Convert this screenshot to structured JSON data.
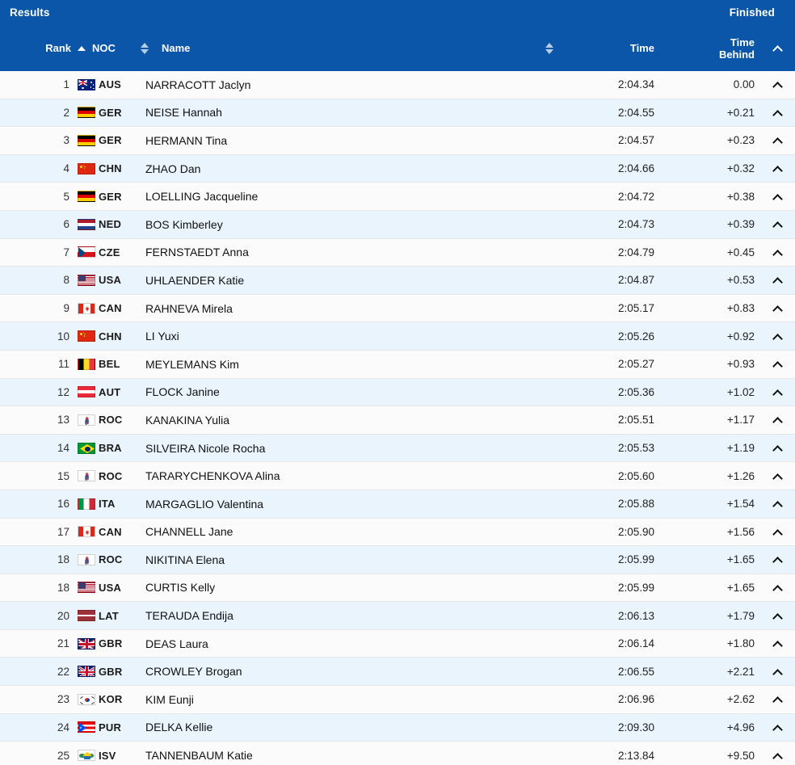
{
  "header": {
    "title": "Results",
    "status": "Finished",
    "columns": {
      "rank": "Rank",
      "noc": "NOC",
      "name": "Name",
      "time": "Time",
      "time_behind_line1": "Time",
      "time_behind_line2": "Behind"
    },
    "sort": {
      "rank_state": "ascending",
      "noc_state": "none",
      "name_state": "none"
    },
    "collapse_icon": "chevron-up-icon"
  },
  "colors": {
    "header_blue": "#0b56a8",
    "row_odd": "#fbfbfb",
    "row_even": "#eaf4fc",
    "row_border": "#e3e7ea",
    "text": "#1b1b1b"
  },
  "rows": [
    {
      "rank": "1",
      "noc": "AUS",
      "name": "NARRACOTT Jaclyn",
      "time": "2:04.34",
      "behind": "0.00"
    },
    {
      "rank": "2",
      "noc": "GER",
      "name": "NEISE Hannah",
      "time": "2:04.55",
      "behind": "+0.21"
    },
    {
      "rank": "3",
      "noc": "GER",
      "name": "HERMANN Tina",
      "time": "2:04.57",
      "behind": "+0.23"
    },
    {
      "rank": "4",
      "noc": "CHN",
      "name": "ZHAO Dan",
      "time": "2:04.66",
      "behind": "+0.32"
    },
    {
      "rank": "5",
      "noc": "GER",
      "name": "LOELLING Jacqueline",
      "time": "2:04.72",
      "behind": "+0.38"
    },
    {
      "rank": "6",
      "noc": "NED",
      "name": "BOS Kimberley",
      "time": "2:04.73",
      "behind": "+0.39"
    },
    {
      "rank": "7",
      "noc": "CZE",
      "name": "FERNSTAEDT Anna",
      "time": "2:04.79",
      "behind": "+0.45"
    },
    {
      "rank": "8",
      "noc": "USA",
      "name": "UHLAENDER Katie",
      "time": "2:04.87",
      "behind": "+0.53"
    },
    {
      "rank": "9",
      "noc": "CAN",
      "name": "RAHNEVA Mirela",
      "time": "2:05.17",
      "behind": "+0.83"
    },
    {
      "rank": "10",
      "noc": "CHN",
      "name": "LI Yuxi",
      "time": "2:05.26",
      "behind": "+0.92"
    },
    {
      "rank": "11",
      "noc": "BEL",
      "name": "MEYLEMANS Kim",
      "time": "2:05.27",
      "behind": "+0.93"
    },
    {
      "rank": "12",
      "noc": "AUT",
      "name": "FLOCK Janine",
      "time": "2:05.36",
      "behind": "+1.02"
    },
    {
      "rank": "13",
      "noc": "ROC",
      "name": "KANAKINA Yulia",
      "time": "2:05.51",
      "behind": "+1.17"
    },
    {
      "rank": "14",
      "noc": "BRA",
      "name": "SILVEIRA Nicole Rocha",
      "time": "2:05.53",
      "behind": "+1.19"
    },
    {
      "rank": "15",
      "noc": "ROC",
      "name": "TARARYCHENKOVA Alina",
      "time": "2:05.60",
      "behind": "+1.26"
    },
    {
      "rank": "16",
      "noc": "ITA",
      "name": "MARGAGLIO Valentina",
      "time": "2:05.88",
      "behind": "+1.54"
    },
    {
      "rank": "17",
      "noc": "CAN",
      "name": "CHANNELL Jane",
      "time": "2:05.90",
      "behind": "+1.56"
    },
    {
      "rank": "18",
      "noc": "ROC",
      "name": "NIKITINA Elena",
      "time": "2:05.99",
      "behind": "+1.65"
    },
    {
      "rank": "18",
      "noc": "USA",
      "name": "CURTIS Kelly",
      "time": "2:05.99",
      "behind": "+1.65"
    },
    {
      "rank": "20",
      "noc": "LAT",
      "name": "TERAUDA Endija",
      "time": "2:06.13",
      "behind": "+1.79"
    },
    {
      "rank": "21",
      "noc": "GBR",
      "name": "DEAS Laura",
      "time": "2:06.14",
      "behind": "+1.80"
    },
    {
      "rank": "22",
      "noc": "GBR",
      "name": "CROWLEY Brogan",
      "time": "2:06.55",
      "behind": "+2.21"
    },
    {
      "rank": "23",
      "noc": "KOR",
      "name": "KIM Eunji",
      "time": "2:06.96",
      "behind": "+2.62"
    },
    {
      "rank": "24",
      "noc": "PUR",
      "name": "DELKA Kellie",
      "time": "2:09.30",
      "behind": "+4.96"
    },
    {
      "rank": "25",
      "noc": "ISV",
      "name": "TANNENBAUM Katie",
      "time": "2:13.84",
      "behind": "+9.50"
    }
  ],
  "row_expand_icon": "chevron-up-icon"
}
